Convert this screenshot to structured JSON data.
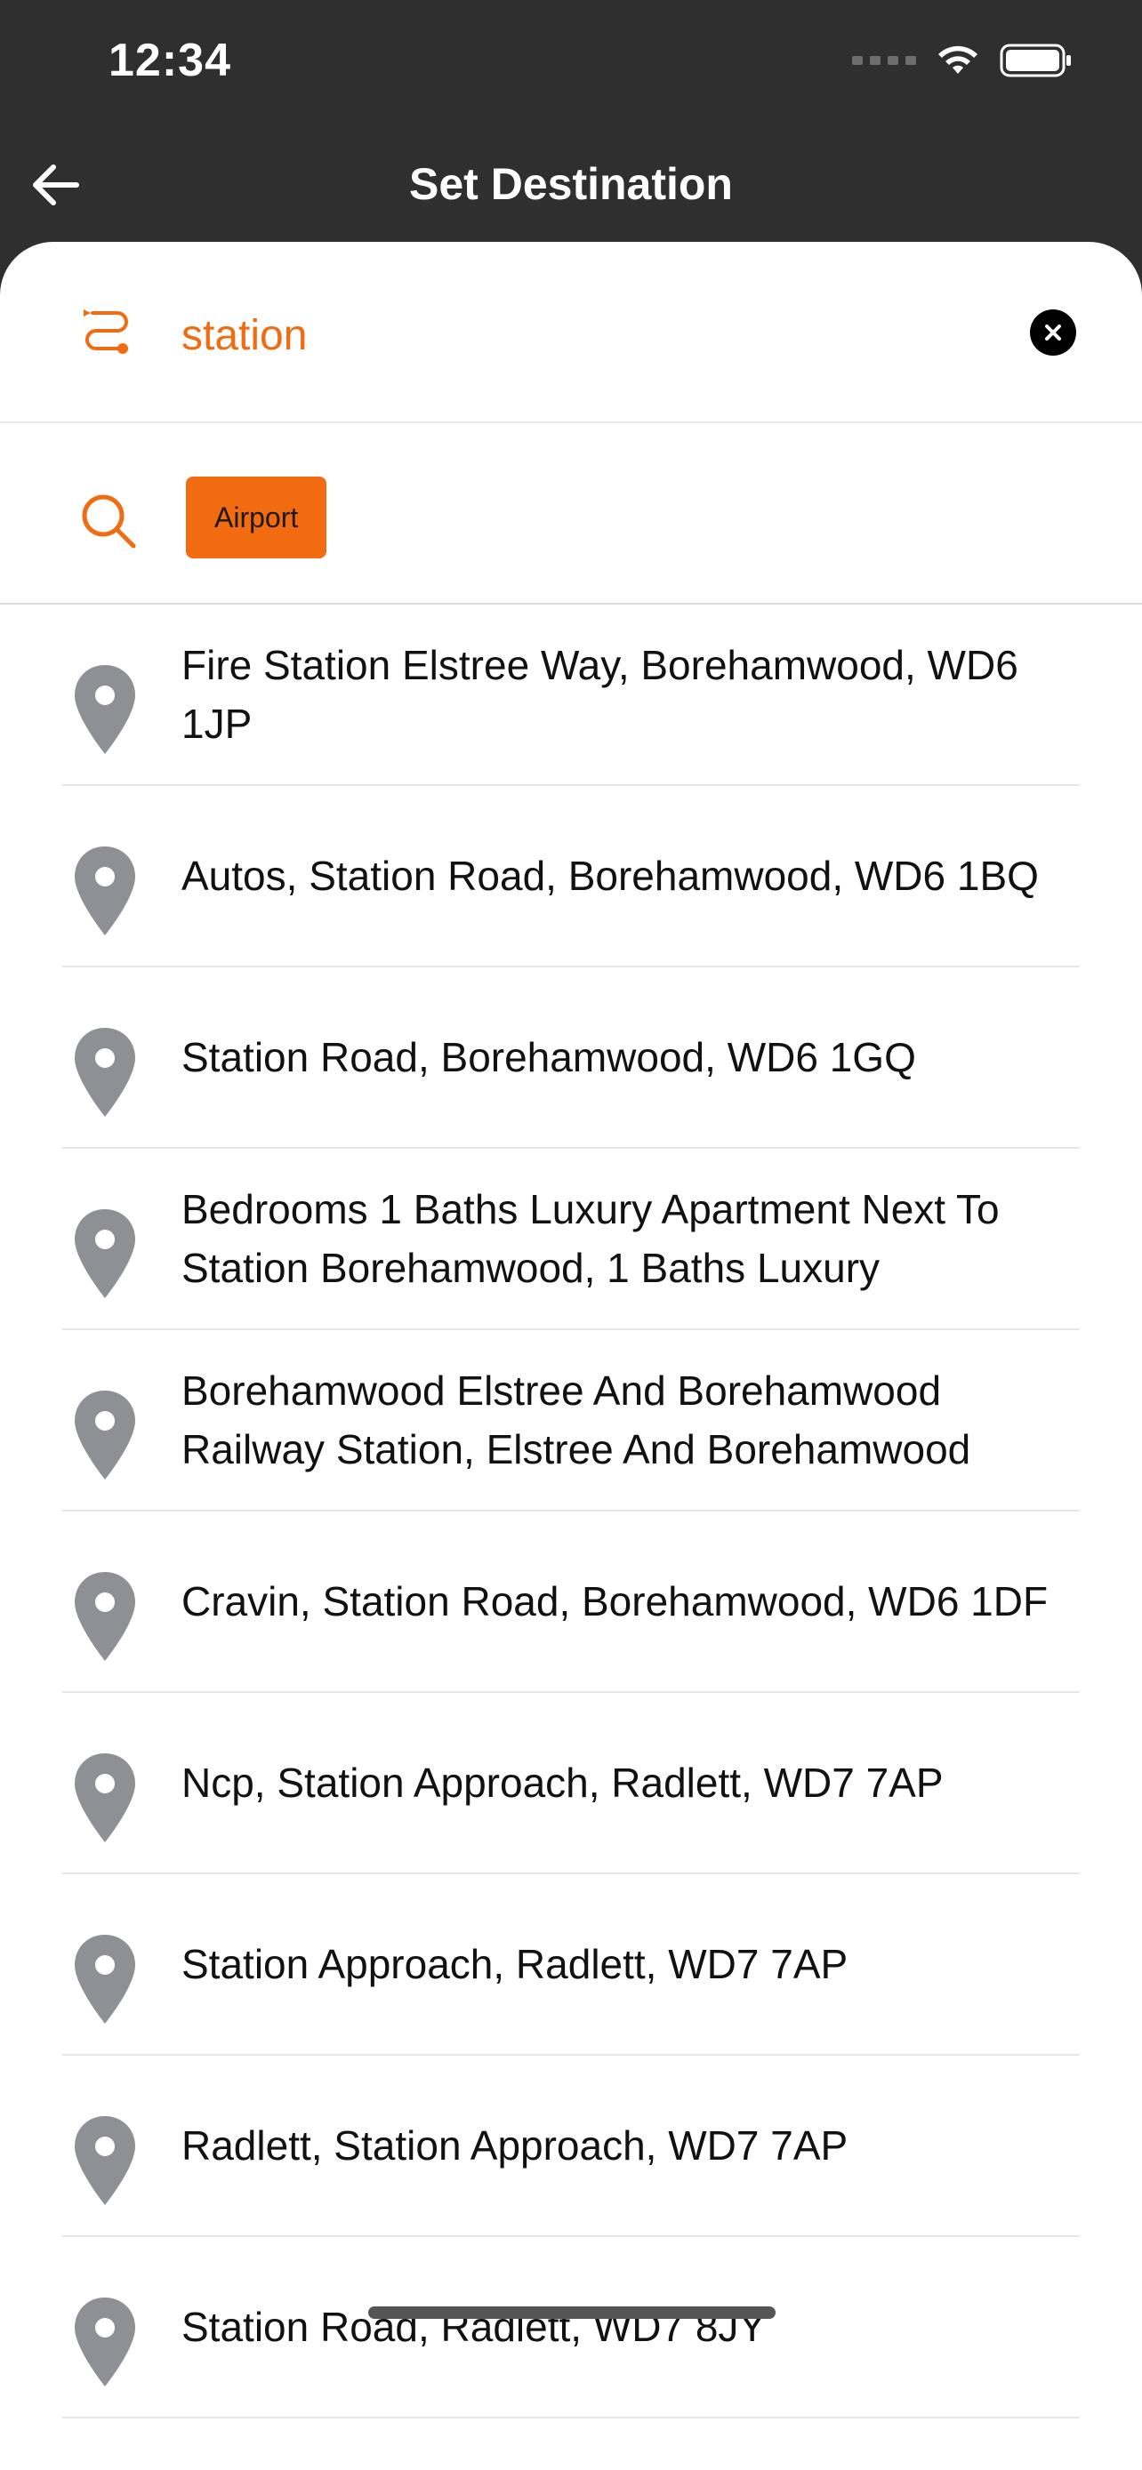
{
  "status_bar": {
    "time": "12:34"
  },
  "header": {
    "title": "Set Destination"
  },
  "search": {
    "value": "station"
  },
  "quick_filters": [
    {
      "label": "Airport"
    }
  ],
  "results": [
    {
      "text": "Fire Station Elstree Way, Borehamwood, WD6 1JP"
    },
    {
      "text": "Autos, Station Road, Borehamwood, WD6 1BQ"
    },
    {
      "text": "Station Road, Borehamwood, WD6 1GQ"
    },
    {
      "text": "Bedrooms 1 Baths Luxury Apartment Next To Station Borehamwood, 1 Baths Luxury"
    },
    {
      "text": "Borehamwood Elstree And Borehamwood Railway Station, Elstree And Borehamwood"
    },
    {
      "text": "Cravin, Station Road, Borehamwood, WD6 1DF"
    },
    {
      "text": "Ncp, Station Approach, Radlett, WD7 7AP"
    },
    {
      "text": "Station Approach, Radlett, WD7 7AP"
    },
    {
      "text": "Radlett, Station Approach, WD7 7AP"
    },
    {
      "text": "Station Road, Radlett, WD7 8JY"
    }
  ],
  "colors": {
    "accent": "#f26b10",
    "header_bg": "#2f2f2f",
    "pin": "#8e9095"
  },
  "icons": [
    "back-arrow-icon",
    "route-icon",
    "clear-icon",
    "search-icon",
    "location-pin-icon",
    "wifi-icon",
    "battery-icon"
  ]
}
